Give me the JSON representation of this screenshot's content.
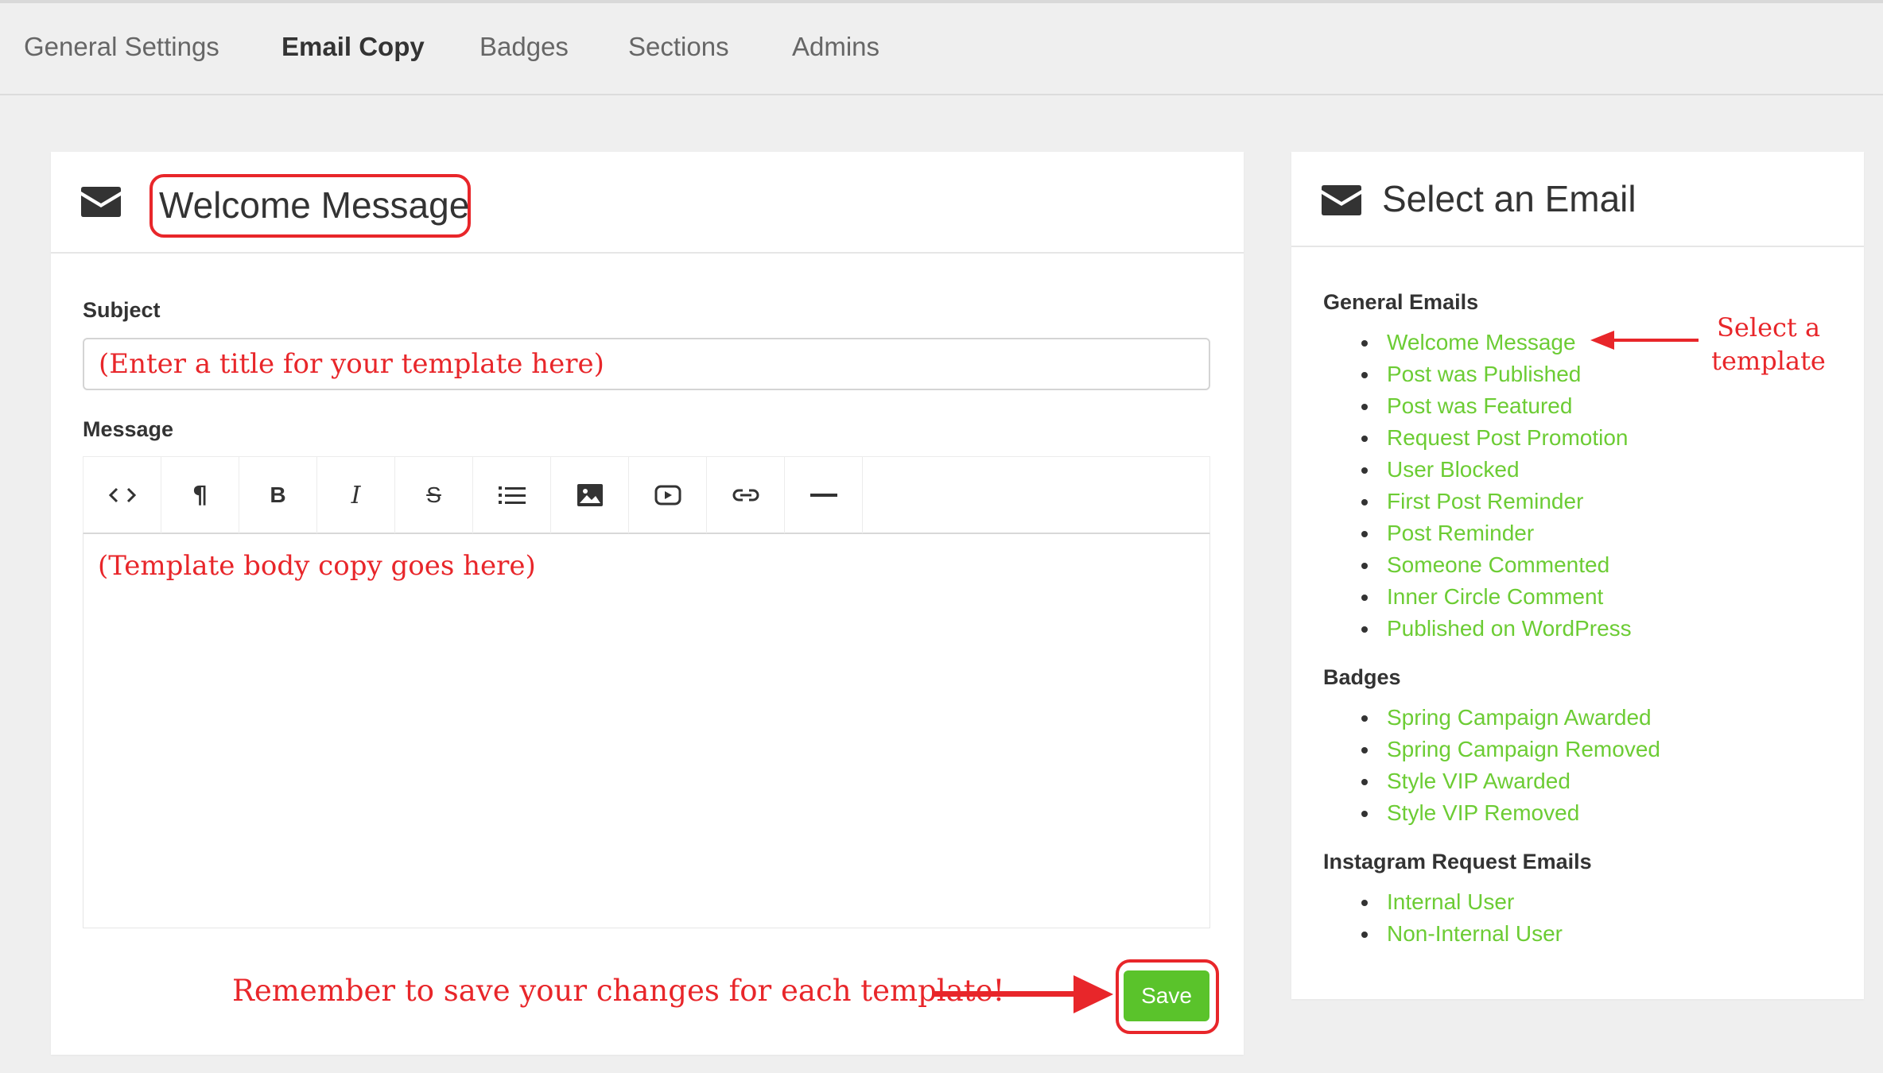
{
  "nav": {
    "tabs": [
      {
        "label": "General Settings",
        "active": false
      },
      {
        "label": "Email Copy",
        "active": true
      },
      {
        "label": "Badges",
        "active": false
      },
      {
        "label": "Sections",
        "active": false
      },
      {
        "label": "Admins",
        "active": false
      }
    ]
  },
  "editor_card": {
    "icon": "envelope-icon",
    "title": "Welcome Message",
    "subject_label": "Subject",
    "subject_value": "(Enter a title for your template here)",
    "message_label": "Message",
    "toolbar": [
      {
        "name": "code-view-icon",
        "glyph": "<>"
      },
      {
        "name": "paragraph-icon",
        "glyph": "¶"
      },
      {
        "name": "bold-icon",
        "glyph": "B"
      },
      {
        "name": "italic-icon",
        "glyph": "I"
      },
      {
        "name": "strikethrough-icon",
        "glyph": "S"
      },
      {
        "name": "list-icon",
        "glyph": "list"
      },
      {
        "name": "image-icon",
        "glyph": "image"
      },
      {
        "name": "video-icon",
        "glyph": "video"
      },
      {
        "name": "link-icon",
        "glyph": "link"
      },
      {
        "name": "horizontal-rule-icon",
        "glyph": "—"
      }
    ],
    "body_text": "(Template body copy goes here)",
    "reminder": "Remember to save your changes for each template!",
    "save_label": "Save"
  },
  "select_card": {
    "icon": "envelope-icon",
    "title": "Select an Email",
    "groups": [
      {
        "title": "General Emails",
        "items": [
          "Welcome Message",
          "Post was Published",
          "Post was Featured",
          "Request Post Promotion",
          "User Blocked",
          "First Post Reminder",
          "Post Reminder",
          "Someone Commented",
          "Inner Circle Comment",
          "Published on WordPress"
        ]
      },
      {
        "title": "Badges",
        "items": [
          "Spring Campaign Awarded",
          "Spring Campaign Removed",
          "Style VIP Awarded",
          "Style VIP Removed"
        ]
      },
      {
        "title": "Instagram Request Emails",
        "items": [
          "Internal User",
          "Non-Internal User"
        ]
      }
    ],
    "annotation_line1": "Select a",
    "annotation_line2": "template"
  },
  "colors": {
    "annotation_red": "#e8262a",
    "link_green": "#6ccc34",
    "save_green": "#5ac32b",
    "background": "#efefef"
  }
}
